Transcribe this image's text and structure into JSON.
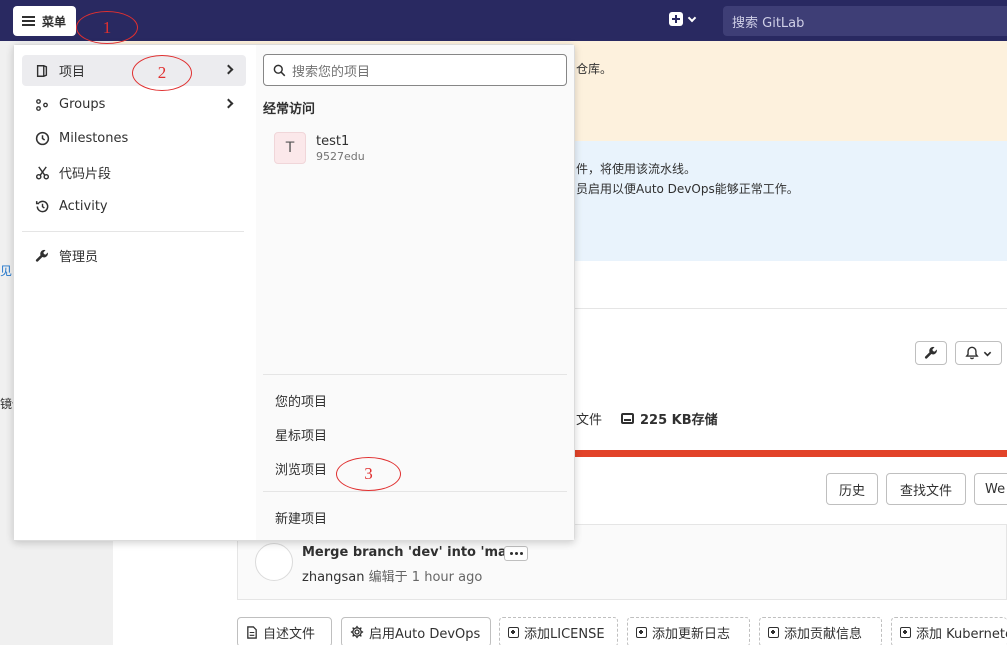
{
  "navbar": {
    "menu_label": "菜单",
    "search_placeholder": "搜索 GitLab"
  },
  "background": {
    "rail_fragment_1": "见",
    "rail_fragment_2": "镜像",
    "warn_text": "仓库。",
    "info_line_1": "件，将使用该流水线。",
    "info_line_2": "员启用以便Auto DevOps能够正常工作。",
    "files_stat": "文件",
    "storage_stat": "225 KB存储",
    "history_button": "历史",
    "find_file_button": "查找文件",
    "web_ide_button": "We",
    "commit": {
      "title": "Merge branch 'dev' into 'main'",
      "author": "zhangsan",
      "edited_label": "编辑于",
      "time": "1 hour ago"
    },
    "actions": [
      {
        "label": "自述文件",
        "icon": "file-icon"
      },
      {
        "label": "启用Auto DevOps",
        "icon": "gear-icon"
      },
      {
        "label": "添加LICENSE",
        "icon": "plus-square-icon"
      },
      {
        "label": "添加更新日志",
        "icon": "plus-square-icon"
      },
      {
        "label": "添加贡献信息",
        "icon": "plus-square-icon"
      },
      {
        "label": "添加 Kubernetes",
        "icon": "plus-square-icon"
      }
    ]
  },
  "menu": {
    "left_items": [
      {
        "label": "项目",
        "icon": "project-icon",
        "has_submenu": true,
        "active": true
      },
      {
        "label": "Groups",
        "icon": "group-icon",
        "has_submenu": true
      },
      {
        "label": "Milestones",
        "icon": "clock-icon"
      },
      {
        "label": "代码片段",
        "icon": "scissors-icon"
      },
      {
        "label": "Activity",
        "icon": "history-icon"
      },
      {
        "label": "管理员",
        "icon": "wrench-icon"
      }
    ],
    "search_placeholder": "搜索您的项目",
    "frequent_header": "经常访问",
    "frequent_projects": [
      {
        "avatar_letter": "T",
        "name": "test1",
        "namespace": "9527edu"
      }
    ],
    "links": {
      "your_projects": "您的项目",
      "starred_projects": "星标项目",
      "explore_projects": "浏览项目",
      "new_project": "新建项目"
    }
  },
  "annotations": [
    "1",
    "2",
    "3"
  ],
  "colors": {
    "navbar": "#292961",
    "annotation": "#e03030",
    "language_bar": "#e24329",
    "warn_banner": "#fdf1dd",
    "info_banner": "#e9f3fc"
  }
}
